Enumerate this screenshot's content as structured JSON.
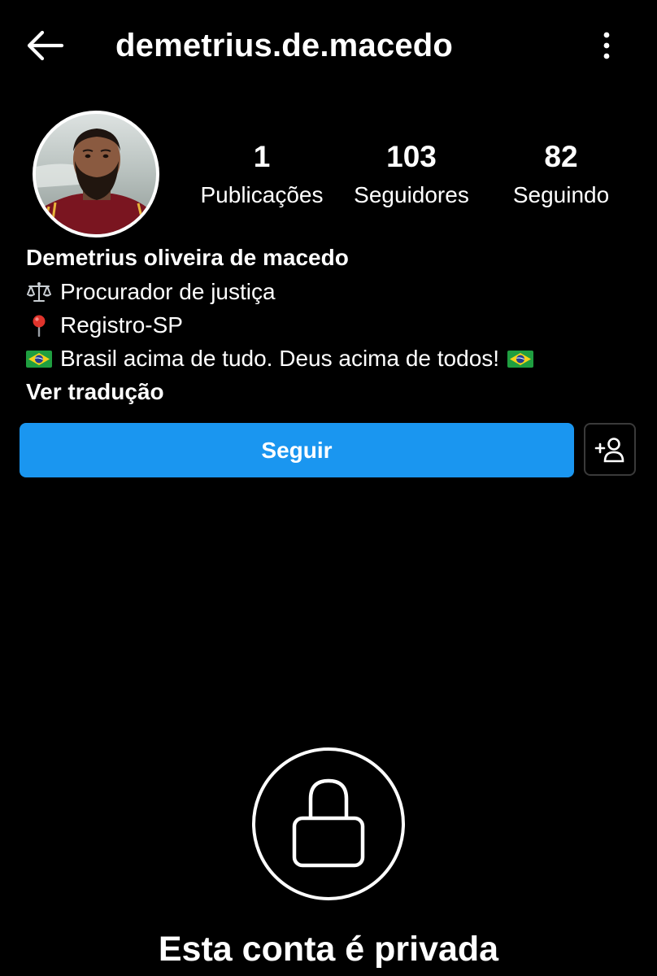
{
  "header": {
    "username": "demetrius.de.macedo",
    "back_icon": "arrow-left-icon",
    "more_icon": "more-vertical-icon"
  },
  "profile": {
    "avatar_icon": "profile-photo",
    "stats": {
      "posts": {
        "value": "1",
        "label": "Publicações"
      },
      "followers": {
        "value": "103",
        "label": "Seguidores"
      },
      "following": {
        "value": "82",
        "label": "Seguindo"
      }
    }
  },
  "bio": {
    "name": "Demetrius oliveira de macedo",
    "lines": [
      {
        "icon": "scales-emoji",
        "text": "Procurador de justiça"
      },
      {
        "icon": "pushpin-emoji",
        "text": "Registro-SP"
      },
      {
        "icon": "brazil-flag-emoji",
        "text": "Brasil acima de tudo. Deus acima de todos!",
        "trailing_icon": "brazil-flag-emoji"
      }
    ],
    "translate_label": "Ver tradução"
  },
  "actions": {
    "follow_label": "Seguir",
    "suggest_icon": "add-person-icon"
  },
  "private_notice": {
    "icon": "lock-icon",
    "title": "Esta conta é privada"
  },
  "colors": {
    "background": "#000000",
    "text": "#ffffff",
    "accent": "#1a96f0",
    "button_border": "#3a3a3a"
  }
}
